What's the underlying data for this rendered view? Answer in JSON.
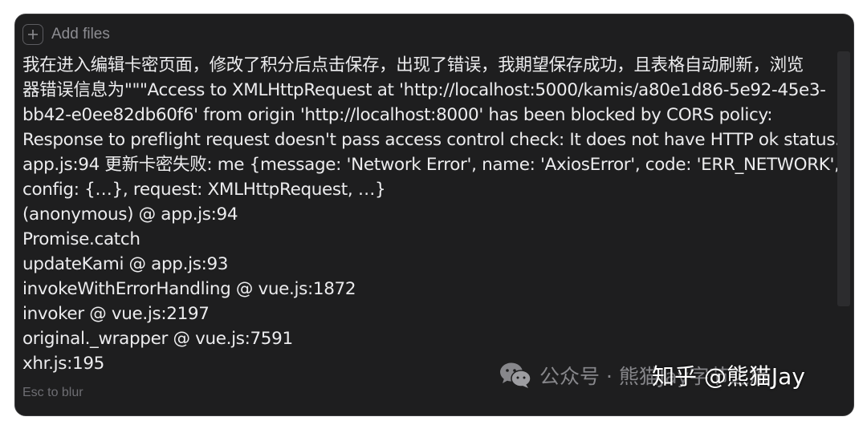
{
  "composer": {
    "add_files_label": "Add files",
    "esc_hint": "Esc to blur"
  },
  "message": {
    "lines": [
      "我在进入编辑卡密页面，修改了积分后点击保存，出现了错误，我期望保存成功，且表格自动刷新，浏览",
      "器错误信息为\"\"\"Access to XMLHttpRequest at 'http://localhost:5000/kamis/a80e1d86-5e92-45e3-",
      "bb42-e0ee82db60f6' from origin 'http://localhost:8000' has been blocked by CORS policy:",
      "Response to preflight request doesn't pass access control check: It does not have HTTP ok status.",
      "app.js:94 更新卡密失败: me {message: 'Network Error', name: 'AxiosError', code: 'ERR_NETWORK',",
      "config: {…}, request: XMLHttpRequest, …}",
      "(anonymous) @ app.js:94",
      "Promise.catch",
      "updateKami @ app.js:93",
      "invokeWithErrorHandling @ vue.js:1872",
      "invoker @ vue.js:2197",
      "original._wrapper @ vue.js:7591",
      "xhr.js:195"
    ]
  },
  "watermarks": {
    "wechat_text": "公众号 · 熊猫Jay字节之旅",
    "zhihu_text": "知乎 @熊猫Jay"
  },
  "icons": {
    "add": "plus-icon",
    "wechat": "wechat-icon"
  },
  "colors": {
    "panel_bg": "#1e1e1f",
    "text": "#ececee",
    "muted": "#8d8d92"
  }
}
